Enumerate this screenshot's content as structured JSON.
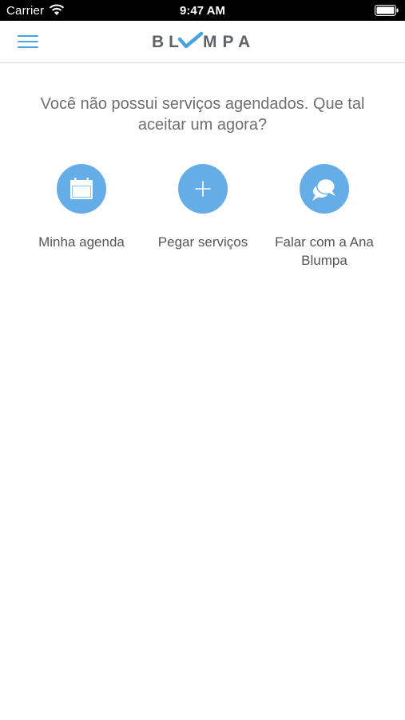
{
  "status_bar": {
    "carrier": "Carrier",
    "time": "9:47 AM"
  },
  "nav": {
    "menu_icon": "hamburger-menu-icon",
    "logo_left": "BL",
    "logo_right": "MPA",
    "logo_mark": "checkmark-icon"
  },
  "empty_state": {
    "message": "Você não possui serviços agendados. Que tal aceitar um agora?"
  },
  "actions": [
    {
      "label": "Minha agenda",
      "icon": "calendar-icon"
    },
    {
      "label": "Pegar serviços",
      "icon": "plus-icon"
    },
    {
      "label": "Falar com a Ana Blumpa",
      "icon": "chat-bubbles-icon"
    }
  ],
  "colors": {
    "accent": "#65ade6",
    "menu": "#4aa3df",
    "logo_text": "#5f6368",
    "text": "#6f6f6f"
  }
}
